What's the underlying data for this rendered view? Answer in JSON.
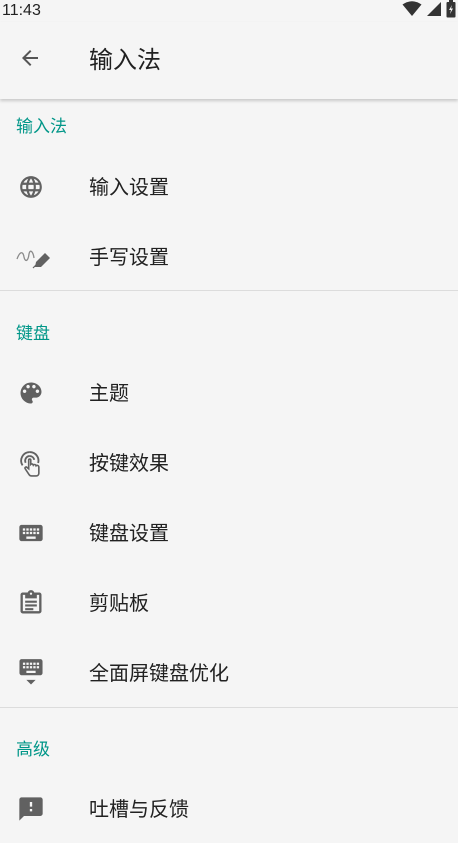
{
  "status_bar": {
    "time": "11:43",
    "icons": [
      "wifi-icon",
      "signal-icon",
      "battery-icon"
    ]
  },
  "app_bar": {
    "back_icon": "arrow-back-icon",
    "title": "输入法"
  },
  "sections": {
    "input": {
      "header": "输入法",
      "items": [
        {
          "label": "输入设置",
          "icon": "globe-icon"
        },
        {
          "label": "手写设置",
          "icon": "handwriting-icon"
        }
      ]
    },
    "keyboard": {
      "header": "键盘",
      "items": [
        {
          "label": "主题",
          "icon": "palette-icon"
        },
        {
          "label": "按键效果",
          "icon": "touch-icon"
        },
        {
          "label": "键盘设置",
          "icon": "keyboard-icon"
        },
        {
          "label": "剪贴板",
          "icon": "clipboard-icon"
        },
        {
          "label": "全面屏键盘优化",
          "icon": "keyboard-hide-icon"
        }
      ]
    },
    "advanced": {
      "header": "高级",
      "items": [
        {
          "label": "吐槽与反馈",
          "icon": "feedback-icon"
        }
      ]
    }
  },
  "colors": {
    "background": "#f5f5f5",
    "accent": "#009688",
    "icon": "#616161",
    "text": "#212121"
  }
}
